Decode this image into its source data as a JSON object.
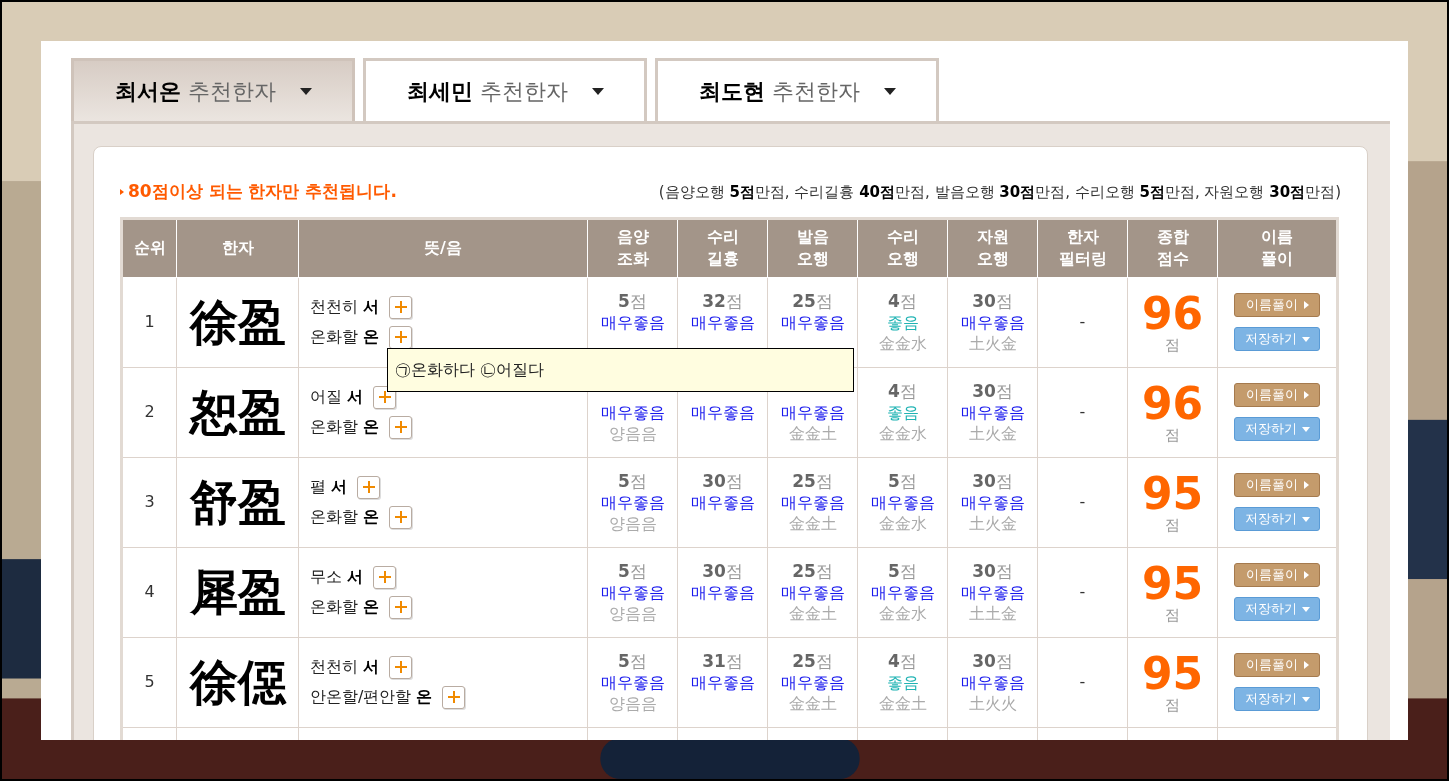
{
  "tabs": [
    {
      "name": "최서온",
      "label": "추천한자",
      "selected": true
    },
    {
      "name": "최세민",
      "label": "추천한자",
      "selected": false
    },
    {
      "name": "최도현",
      "label": "추천한자",
      "selected": false
    }
  ],
  "notice": "80점이상 되는 한자만 추천됩니다.",
  "criteria": "(음양오행 **5점**만점, 수리길흉 **40점**만점, 발음오행 **30점**만점, 수리오행 **5점**만점, 자원오행 **30점**만점)",
  "table": {
    "columns": [
      [
        "순위"
      ],
      [
        "한자"
      ],
      [
        "뜻/음"
      ],
      [
        "음양",
        "조화"
      ],
      [
        "수리",
        "길흉"
      ],
      [
        "발음",
        "오행"
      ],
      [
        "수리",
        "오행"
      ],
      [
        "자원",
        "오행"
      ],
      [
        "한자",
        "필터링"
      ],
      [
        "종합",
        "점수"
      ],
      [
        "이름",
        "풀이"
      ]
    ],
    "rows": [
      {
        "rank": "1",
        "hanja": "徐盈",
        "meanings": [
          {
            "gloss": "천천히",
            "sound": "서"
          },
          {
            "gloss": "온화할",
            "sound": "온"
          }
        ],
        "scores": [
          {
            "points": "**5**점",
            "verdict": "매우좋음",
            "color": "#1a1aee"
          },
          {
            "points": "**32**점",
            "verdict": "매우좋음",
            "color": "#1a1aee"
          },
          {
            "points": "**25**점",
            "verdict": "매우좋음",
            "color": "#1a1aee"
          },
          {
            "points": "**4**점",
            "verdict": "좋음",
            "color": "#1fb3b3",
            "element": "金金水"
          },
          {
            "points": "**30**점",
            "verdict": "매우좋음",
            "color": "#1a1aee",
            "element": "土火金"
          }
        ],
        "filter": "-",
        "total": "96",
        "unit": "점",
        "actions": [
          "이름풀이",
          "저장하기"
        ]
      },
      {
        "rank": "2",
        "hanja": "恕盈",
        "meanings": [
          {
            "gloss": "어질",
            "sound": "서"
          },
          {
            "gloss": "온화할",
            "sound": "온"
          }
        ],
        "scores": [
          {
            "verdict": "매우좋음",
            "color": "#1a1aee",
            "element": "양음음"
          },
          {
            "verdict": "매우좋음",
            "color": "#1a1aee"
          },
          {
            "verdict": "매우좋음",
            "color": "#1a1aee",
            "element": "金金土"
          },
          {
            "points": "**4**점",
            "verdict": "좋음",
            "color": "#1fb3b3",
            "element": "金金水"
          },
          {
            "points": "**30**점",
            "verdict": "매우좋음",
            "color": "#1a1aee",
            "element": "土火金"
          }
        ],
        "filter": "-",
        "total": "96",
        "unit": "점",
        "actions": [
          "이름풀이",
          "저장하기"
        ]
      },
      {
        "rank": "3",
        "hanja": "舒盈",
        "meanings": [
          {
            "gloss": "펼",
            "sound": "서"
          },
          {
            "gloss": "온화할",
            "sound": "온"
          }
        ],
        "scores": [
          {
            "points": "**5**점",
            "verdict": "매우좋음",
            "color": "#1a1aee",
            "element": "양음음"
          },
          {
            "points": "**30**점",
            "verdict": "매우좋음",
            "color": "#1a1aee"
          },
          {
            "points": "**25**점",
            "verdict": "매우좋음",
            "color": "#1a1aee",
            "element": "金金土"
          },
          {
            "points": "**5**점",
            "verdict": "매우좋음",
            "color": "#1a1aee",
            "element": "金金水"
          },
          {
            "points": "**30**점",
            "verdict": "매우좋음",
            "color": "#1a1aee",
            "element": "土火金"
          }
        ],
        "filter": "-",
        "total": "95",
        "unit": "점",
        "actions": [
          "이름풀이",
          "저장하기"
        ]
      },
      {
        "rank": "4",
        "hanja": "犀盈",
        "meanings": [
          {
            "gloss": "무소",
            "sound": "서"
          },
          {
            "gloss": "온화할",
            "sound": "온"
          }
        ],
        "scores": [
          {
            "points": "**5**점",
            "verdict": "매우좋음",
            "color": "#1a1aee",
            "element": "양음음"
          },
          {
            "points": "**30**점",
            "verdict": "매우좋음",
            "color": "#1a1aee"
          },
          {
            "points": "**25**점",
            "verdict": "매우좋음",
            "color": "#1a1aee",
            "element": "金金土"
          },
          {
            "points": "**5**점",
            "verdict": "매우좋음",
            "color": "#1a1aee",
            "element": "金金水"
          },
          {
            "points": "**30**점",
            "verdict": "매우좋음",
            "color": "#1a1aee",
            "element": "土土金"
          }
        ],
        "filter": "-",
        "total": "95",
        "unit": "점",
        "actions": [
          "이름풀이",
          "저장하기"
        ]
      },
      {
        "rank": "5",
        "hanja": "徐僫",
        "meanings": [
          {
            "gloss": "천천히",
            "sound": "서"
          },
          {
            "gloss": "안온할/편안할",
            "sound": "온"
          }
        ],
        "scores": [
          {
            "points": "**5**점",
            "verdict": "매우좋음",
            "color": "#1a1aee",
            "element": "양음음"
          },
          {
            "points": "**31**점",
            "verdict": "매우좋음",
            "color": "#1a1aee"
          },
          {
            "points": "**25**점",
            "verdict": "매우좋음",
            "color": "#1a1aee",
            "element": "金金土"
          },
          {
            "points": "**4**점",
            "verdict": "좋음",
            "color": "#1fb3b3",
            "element": "金金土"
          },
          {
            "points": "**30**점",
            "verdict": "매우좋음",
            "color": "#1a1aee",
            "element": "土火火"
          }
        ],
        "filter": "-",
        "total": "95",
        "unit": "점",
        "actions": [
          "이름풀이",
          "저장하기"
        ]
      }
    ]
  },
  "tooltip": {
    "text": "㉠온화하다 ㉡어질다"
  }
}
